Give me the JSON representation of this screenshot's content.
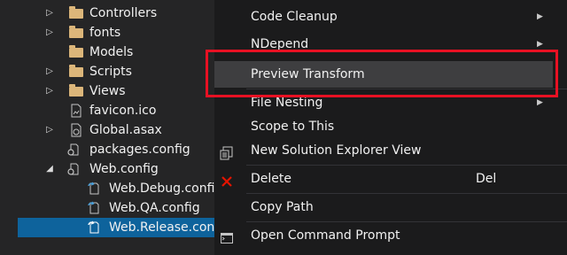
{
  "solution_explorer": {
    "items": [
      {
        "label": "Controllers",
        "type": "folder",
        "expander": "collapsed"
      },
      {
        "label": "fonts",
        "type": "folder",
        "expander": "collapsed"
      },
      {
        "label": "Models",
        "type": "folder",
        "expander": "none"
      },
      {
        "label": "Scripts",
        "type": "folder",
        "expander": "collapsed"
      },
      {
        "label": "Views",
        "type": "folder",
        "expander": "collapsed"
      },
      {
        "label": "favicon.ico",
        "type": "file",
        "expander": "none"
      },
      {
        "label": "Global.asax",
        "type": "file",
        "expander": "collapsed"
      },
      {
        "label": "packages.config",
        "type": "config",
        "expander": "none"
      },
      {
        "label": "Web.config",
        "type": "config",
        "expander": "expanded"
      },
      {
        "label": "Web.Debug.config",
        "type": "config",
        "expander": "none"
      },
      {
        "label": "Web.QA.config",
        "type": "config",
        "expander": "none"
      },
      {
        "label": "Web.Release.config",
        "type": "config",
        "expander": "none",
        "selected": true
      }
    ]
  },
  "context_menu": {
    "items": [
      {
        "label": "Code Cleanup",
        "submenu": true
      },
      {
        "label": "NDepend",
        "submenu": true
      },
      {
        "label": "Preview Transform",
        "highlighted": true
      },
      {
        "label": "File Nesting",
        "submenu": true
      },
      {
        "label": "Scope to This"
      },
      {
        "label": "New Solution Explorer View",
        "icon": "new-view-icon"
      },
      {
        "label": "Delete",
        "shortcut": "Del",
        "icon": "delete-x-icon"
      },
      {
        "label": "Copy Path"
      },
      {
        "label": "Open Command Prompt",
        "icon": "command-prompt-icon"
      }
    ]
  },
  "colors": {
    "selection": "#0e639c",
    "menu_highlight": "#3e3e40",
    "callout_border": "#e81123",
    "folder": "#dcb67a",
    "delete_icon": "#e51400"
  }
}
